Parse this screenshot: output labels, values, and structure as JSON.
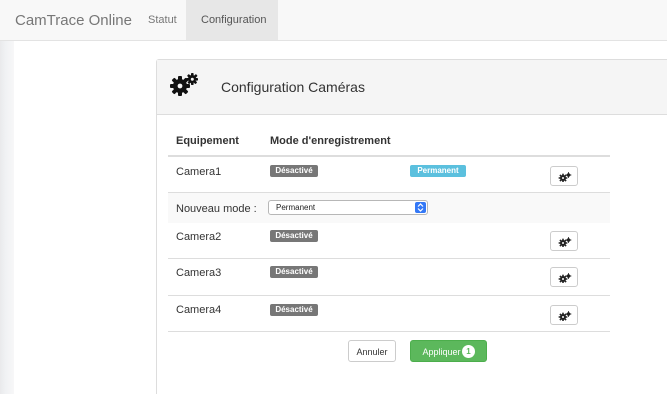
{
  "navbar": {
    "brand": "CamTrace Online",
    "links": [
      {
        "label": "Statut",
        "active": false
      },
      {
        "label": "Configuration",
        "active": true
      }
    ]
  },
  "panel": {
    "icon": "gears-icon",
    "title": "Configuration Caméras"
  },
  "table": {
    "headers": [
      "Equipement",
      "Mode d'enregistrement"
    ],
    "rows": [
      {
        "name": "Camera1",
        "mode": "Désactivé",
        "new_mode": "Permanent",
        "action_icon": "gears-icon"
      },
      {
        "name": "Camera2",
        "mode": "Désactivé",
        "action_icon": "gears-icon"
      },
      {
        "name": "Camera3",
        "mode": "Désactivé",
        "action_icon": "gears-icon"
      },
      {
        "name": "Camera4",
        "mode": "Désactivé",
        "action_icon": "gears-icon"
      }
    ],
    "new_mode_row": {
      "label": "Nouveau mode :",
      "select_value": "Permanent"
    }
  },
  "actions": {
    "cancel_label": "Annuler",
    "apply_label": "Appliquer",
    "apply_badge": "1"
  },
  "colors": {
    "label_default": "#777777",
    "label_info": "#5bc0de",
    "button_success": "#5cb85c",
    "select_accent": "#3478f6"
  }
}
